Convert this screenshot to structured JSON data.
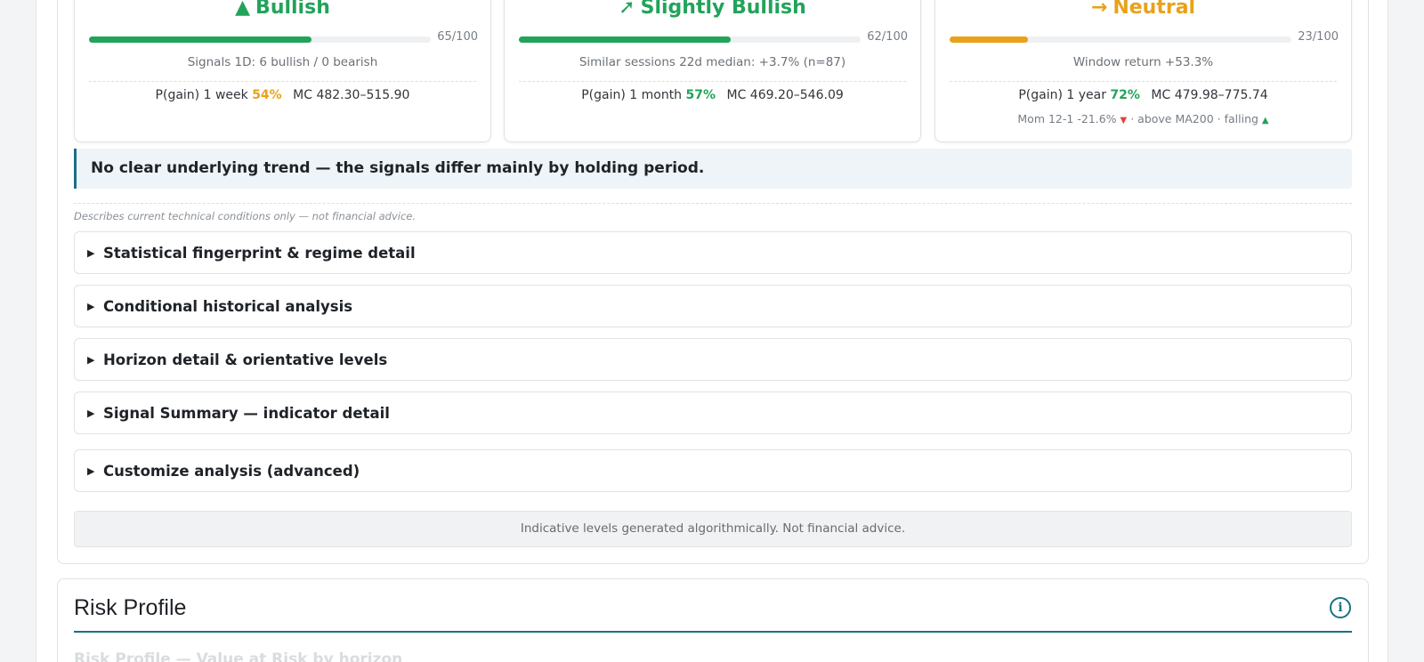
{
  "cards": [
    {
      "arrow": "▲",
      "label": "Bullish",
      "color": "#22a35a",
      "score": "65/100",
      "score_value": 0.65,
      "line1": "Signals 1D: 6 bullish / 0 bearish",
      "pgain_label": "P(gain) 1 week",
      "pgain_value": "54%",
      "pgain_color": "#e8a21a",
      "mc": "MC 482.30–515.90"
    },
    {
      "arrow": "➚",
      "label": "Slightly Bullish",
      "color": "#22a35a",
      "score": "62/100",
      "score_value": 0.62,
      "line1": "Similar sessions 22d median: +3.7% (n=87)",
      "pgain_label": "P(gain) 1 month",
      "pgain_value": "57%",
      "pgain_color": "#22a35a",
      "mc": "MC 469.20–546.09"
    },
    {
      "arrow": "→",
      "label": "Neutral",
      "color": "#e8a21a",
      "score": "23/100",
      "score_value": 0.23,
      "line1": "Window return +53.3%",
      "pgain_label": "P(gain) 1 year",
      "pgain_value": "72%",
      "pgain_color": "#22a35a",
      "mc": "MC 479.98–775.74",
      "momentum": {
        "prefix": "Mom 12-1 -21.6%",
        "down_arrow": "▼",
        "middle": "· above MA200 · falling",
        "up_arrow": "▲"
      }
    }
  ],
  "callout": "No clear underlying trend — the signals differ mainly by holding period.",
  "disclaimer": "Describes current technical conditions only — not financial advice.",
  "accordions": [
    "Statistical fingerprint & regime detail",
    "Conditional historical analysis",
    "Horizon detail & orientative levels",
    "Signal Summary — indicator detail",
    "Customize analysis (advanced)"
  ],
  "caret_icon": "▶",
  "footer_note": "Indicative levels generated algorithmically. Not financial advice.",
  "risk": {
    "title": "Risk Profile",
    "subtitle": "Risk Profile — Value at Risk by horizon",
    "info_icon": "info-icon"
  },
  "colors": {
    "accent": "#1b6f86",
    "bullish": "#22a35a",
    "neutral": "#e8a21a",
    "bearish": "#e0413a"
  }
}
